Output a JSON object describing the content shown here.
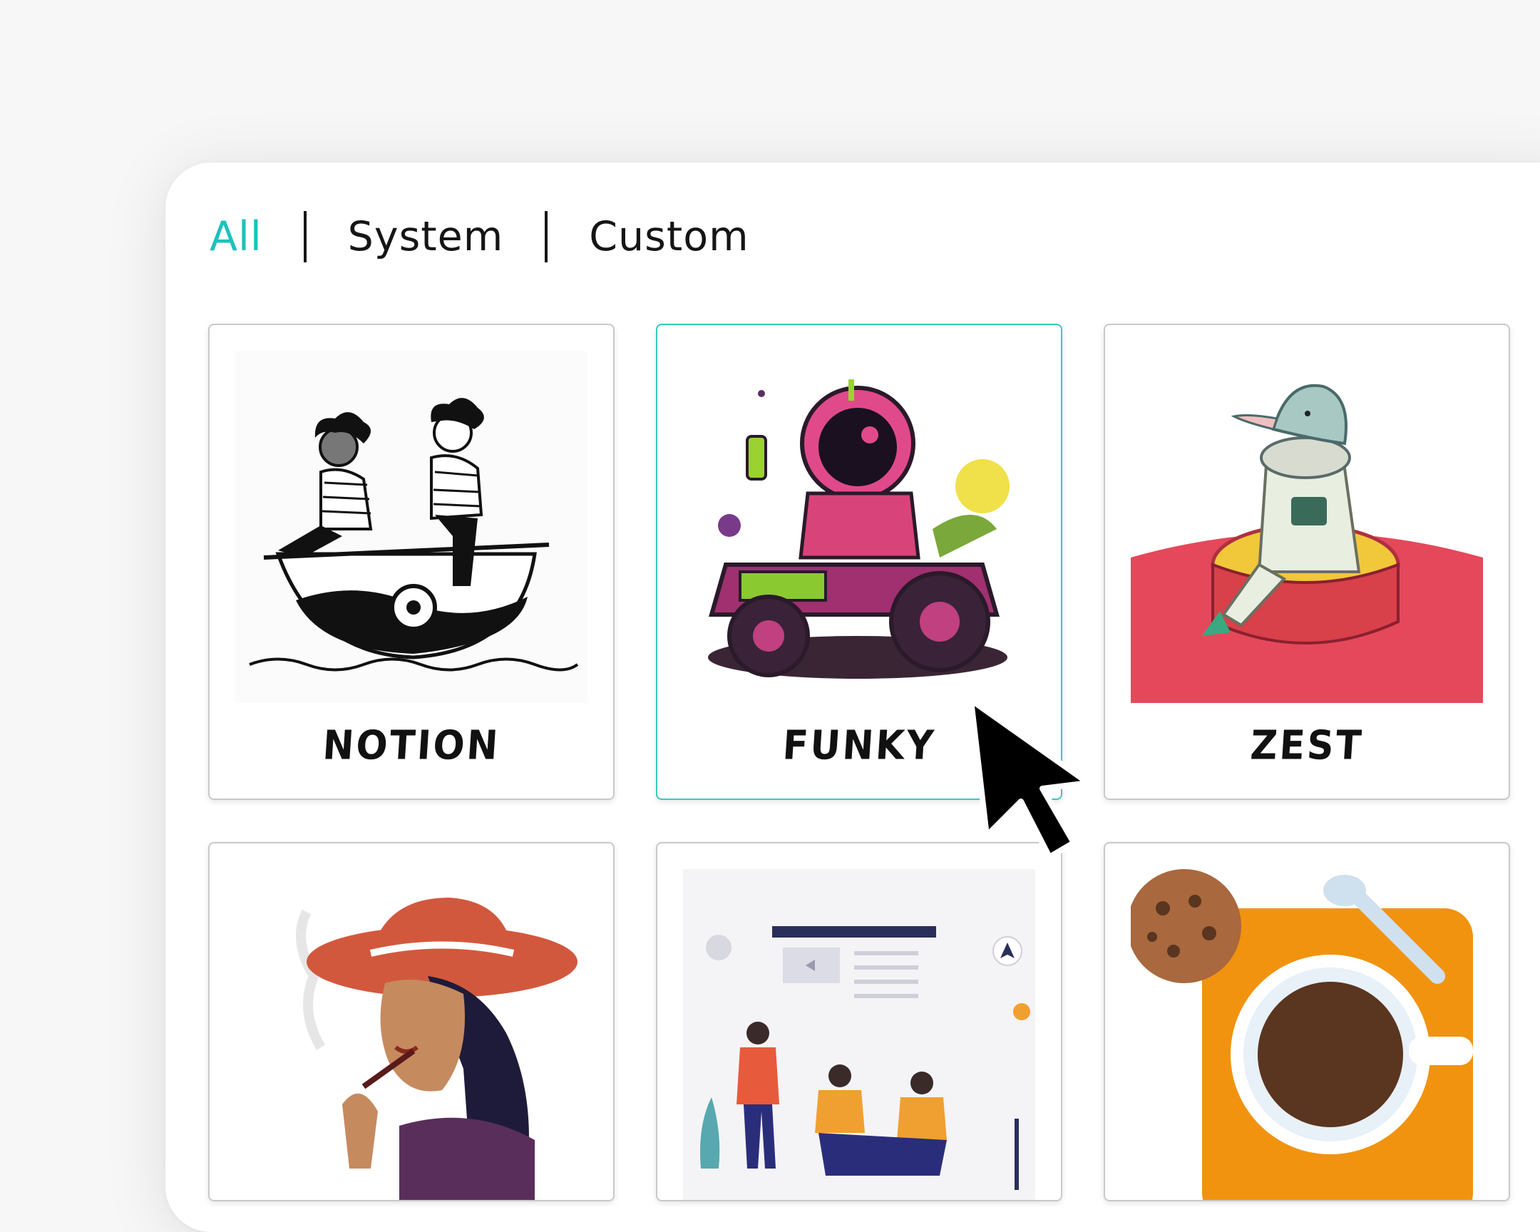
{
  "tabs": [
    {
      "label": "All",
      "active": true
    },
    {
      "label": "System",
      "active": false
    },
    {
      "label": "Custom",
      "active": false
    }
  ],
  "styles": [
    {
      "label": "NOTION",
      "selected": false
    },
    {
      "label": "FUNKY",
      "selected": true
    },
    {
      "label": "ZEST",
      "selected": false
    },
    {
      "label": "",
      "selected": false
    },
    {
      "label": "",
      "selected": false
    },
    {
      "label": "",
      "selected": false
    }
  ],
  "colors": {
    "accent": "#1cc3bb",
    "text": "#151515",
    "card_border": "#c9c9c9"
  }
}
